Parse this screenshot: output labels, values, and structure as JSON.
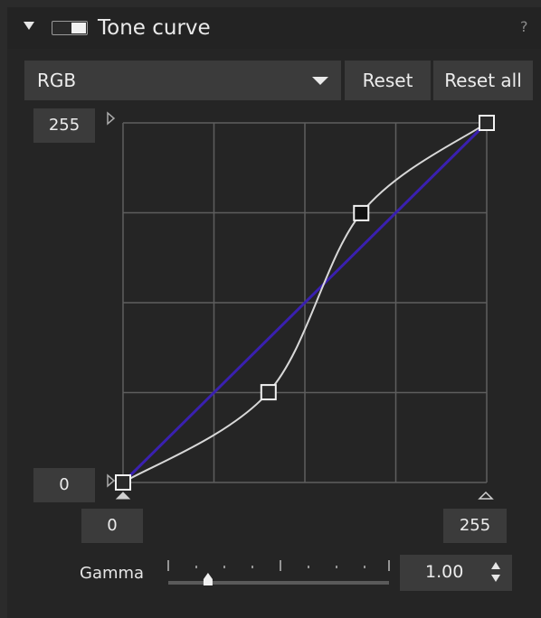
{
  "panel": {
    "title": "Tone curve",
    "help_label": "?",
    "icons": {
      "collapse": "collapse-triangle-icon",
      "toggle": "toggle-switch-icon",
      "help": "help-icon"
    }
  },
  "controls": {
    "channel": "RGB",
    "reset_label": "Reset",
    "reset_all_label": "Reset all"
  },
  "curve": {
    "output_max": "255",
    "output_min": "0",
    "input_min": "0",
    "input_max": "255",
    "grid_divisions": 4,
    "control_points": [
      {
        "input": 0,
        "output": 0,
        "selected": false
      },
      {
        "input": 102,
        "output": 64,
        "selected": false
      },
      {
        "input": 167,
        "output": 191,
        "selected": true
      },
      {
        "input": 255,
        "output": 255,
        "selected": false
      }
    ],
    "reference_line_color": "#3a20b0",
    "curve_color": "#d8d8d8"
  },
  "gamma": {
    "label": "Gamma",
    "value": "1.00",
    "slider_fraction": 0.18
  }
}
